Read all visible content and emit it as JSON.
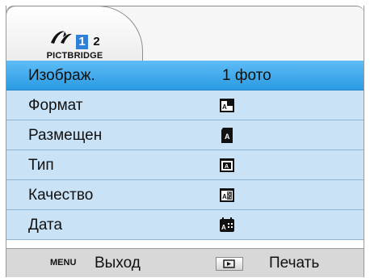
{
  "header": {
    "tab_label": "PICTBRIDGE",
    "mode_icon": "pictbridge-connection-icon",
    "pages": [
      "1",
      "2"
    ],
    "active_page": "1"
  },
  "menu": {
    "items": [
      {
        "label": "Изображ.",
        "value": "1 фото",
        "selected": true
      },
      {
        "label": "Формат",
        "icon": "paper-size-icon"
      },
      {
        "label": "Размещен",
        "icon": "layout-icon"
      },
      {
        "label": "Тип",
        "icon": "paper-type-icon"
      },
      {
        "label": "Качество",
        "icon": "quality-icon"
      },
      {
        "label": "Дата",
        "icon": "date-icon"
      }
    ]
  },
  "footer": {
    "menu_key": "MENU",
    "exit_label": "Выход",
    "play_key_icon": "playback-icon",
    "print_label": "Печать"
  },
  "colors": {
    "selected_row": "#2a9be3",
    "row_background": "#c9e2f6",
    "page_active": "#2f80d8"
  }
}
